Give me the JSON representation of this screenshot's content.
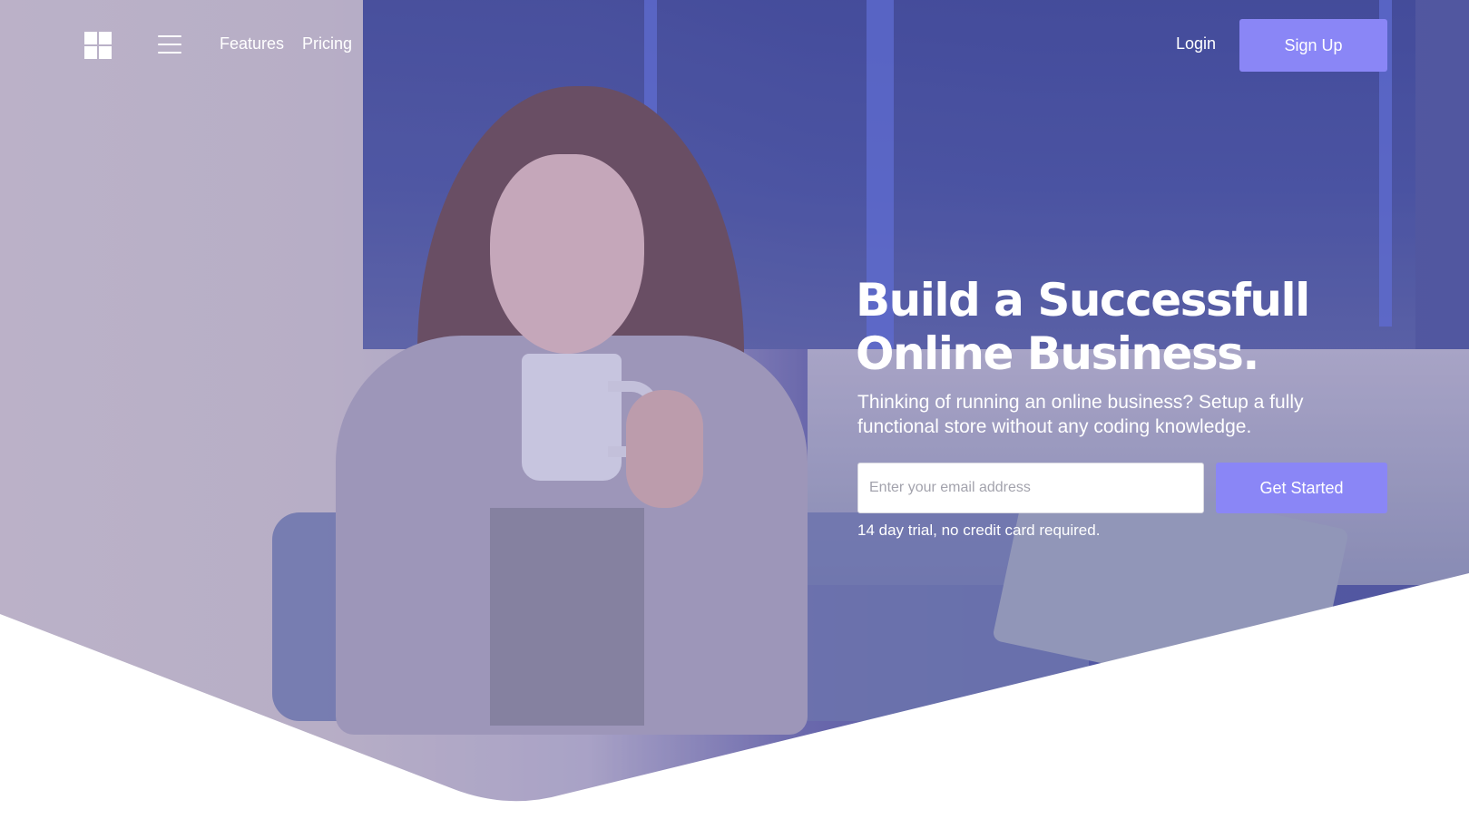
{
  "header": {
    "logo_icon": "windows-grid-icon",
    "menu_icon": "hamburger-menu-icon",
    "nav": [
      {
        "label": "Features"
      },
      {
        "label": "Pricing"
      }
    ],
    "login_label": "Login",
    "signup_label": "Sign Up"
  },
  "hero": {
    "headline_line1": "Build a Successfull",
    "headline_line2": "Online Business.",
    "subtext": "Thinking of running an online business? Setup a fully functional store without any coding knowledge.",
    "email_placeholder": "Enter your email address",
    "email_value": "",
    "cta_label": "Get Started",
    "note": "14 day trial, no credit card required."
  },
  "colors": {
    "accent": "#8a86f6",
    "text_on_image": "#ffffff",
    "background": "#ffffff"
  }
}
